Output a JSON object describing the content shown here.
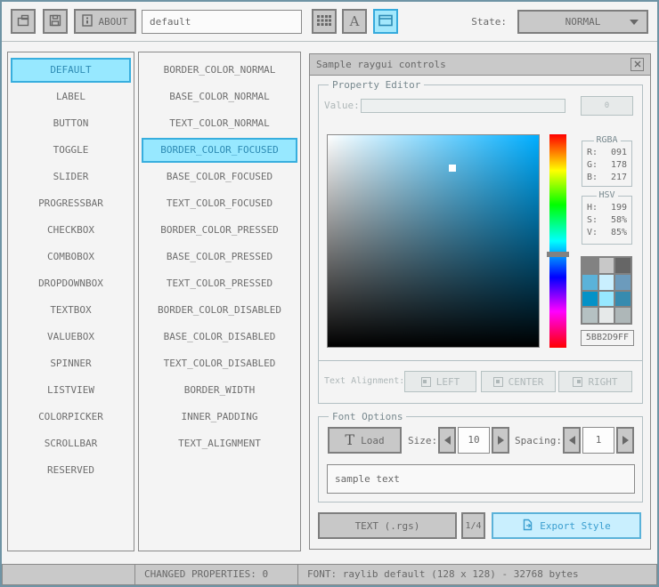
{
  "toolbar": {
    "about_label": "ABOUT",
    "style_name": "default",
    "font_icon_char": "A",
    "state_label": "State:",
    "state_value": "NORMAL"
  },
  "controls_list": [
    {
      "label": "DEFAULT",
      "selected": true
    },
    {
      "label": "LABEL"
    },
    {
      "label": "BUTTON"
    },
    {
      "label": "TOGGLE"
    },
    {
      "label": "SLIDER"
    },
    {
      "label": "PROGRESSBAR"
    },
    {
      "label": "CHECKBOX"
    },
    {
      "label": "COMBOBOX"
    },
    {
      "label": "DROPDOWNBOX"
    },
    {
      "label": "TEXTBOX"
    },
    {
      "label": "VALUEBOX"
    },
    {
      "label": "SPINNER"
    },
    {
      "label": "LISTVIEW"
    },
    {
      "label": "COLORPICKER"
    },
    {
      "label": "SCROLLBAR"
    },
    {
      "label": "RESERVED"
    }
  ],
  "properties_list": [
    {
      "label": "BORDER_COLOR_NORMAL"
    },
    {
      "label": "BASE_COLOR_NORMAL"
    },
    {
      "label": "TEXT_COLOR_NORMAL"
    },
    {
      "label": "BORDER_COLOR_FOCUSED",
      "selected": true
    },
    {
      "label": "BASE_COLOR_FOCUSED"
    },
    {
      "label": "TEXT_COLOR_FOCUSED"
    },
    {
      "label": "BORDER_COLOR_PRESSED"
    },
    {
      "label": "BASE_COLOR_PRESSED"
    },
    {
      "label": "TEXT_COLOR_PRESSED"
    },
    {
      "label": "BORDER_COLOR_DISABLED"
    },
    {
      "label": "BASE_COLOR_DISABLED"
    },
    {
      "label": "TEXT_COLOR_DISABLED"
    },
    {
      "label": "BORDER_WIDTH"
    },
    {
      "label": "INNER_PADDING"
    },
    {
      "label": "TEXT_ALIGNMENT"
    }
  ],
  "window": {
    "title": "Sample raygui controls",
    "property_editor": {
      "label": "Property Editor",
      "value_label": "Value:",
      "value_text": "",
      "value_button_label": "0",
      "rgba_label": "RGBA",
      "rgba_rows": [
        {
          "k": "R:",
          "v": "091"
        },
        {
          "k": "G:",
          "v": "178"
        },
        {
          "k": "B:",
          "v": "217"
        }
      ],
      "hsv_label": "HSV",
      "hsv_rows": [
        {
          "k": "H:",
          "v": "199"
        },
        {
          "k": "S:",
          "v": "58%"
        },
        {
          "k": "V:",
          "v": "85%"
        }
      ],
      "swatches": [
        "#828282",
        "#c8c8c8",
        "#666666",
        "#5bb2d9",
        "#c9effe",
        "#6c9bbc",
        "#0492c7",
        "#97e8ff",
        "#368baf",
        "#b5c1c2",
        "#e6e9e9",
        "#aeb7b8"
      ],
      "hex_value": "5BB2D9FF",
      "alignment_label": "Text Alignment:",
      "align_left_label": "LEFT",
      "align_center_label": "CENTER",
      "align_right_label": "RIGHT"
    },
    "font_options": {
      "label": "Font Options",
      "load_icon_char": "T",
      "load_label": "Load",
      "size_label": "Size:",
      "size_value": "10",
      "spacing_label": "Spacing:",
      "spacing_value": "1",
      "sample_text": "sample text"
    },
    "export_row": {
      "format_label": "TEXT (.rgs)",
      "pager_label": "1/4",
      "export_label": "Export Style"
    }
  },
  "statusbar": {
    "changed_properties": "CHANGED PROPERTIES: 0",
    "font_info": "FONT: raylib default (128 x 128) - 32768 bytes"
  },
  "colorpicker": {
    "hue_degrees": 199,
    "saturation_percent": 58,
    "value_percent": 85,
    "rgb": [
      91,
      178,
      217
    ]
  },
  "colors": {
    "selected_fill": "#97e8ff",
    "selected_border": "#38aede",
    "selected_text": "#2e8bb4",
    "hue_color": "#00aeff",
    "export_fill": "#c9effe",
    "export_border": "#5bb2d9",
    "text": "#686868",
    "disabled_text": "#aeb7b8",
    "button_fill": "#c8c8c8",
    "panel_border": "#8a8a8a"
  }
}
